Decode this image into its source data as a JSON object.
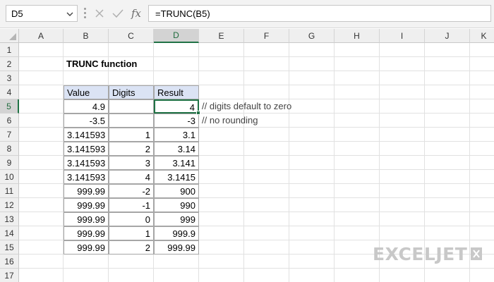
{
  "namebox": {
    "value": "D5"
  },
  "formula_bar": {
    "formula": "=TRUNC(B5)",
    "fx_label": "fx"
  },
  "columns": [
    "A",
    "B",
    "C",
    "D",
    "E",
    "F",
    "G",
    "H",
    "I",
    "J",
    "K"
  ],
  "rows": [
    "1",
    "2",
    "3",
    "4",
    "5",
    "6",
    "7",
    "8",
    "9",
    "10",
    "11",
    "12",
    "13",
    "14",
    "15",
    "16",
    "17"
  ],
  "active_cell": {
    "column": "D",
    "row": "5"
  },
  "sheet": {
    "title": "TRUNC function",
    "table": {
      "headers": [
        "Value",
        "Digits",
        "Result"
      ],
      "rows": [
        {
          "value": "4.9",
          "digits": "",
          "result": "4"
        },
        {
          "value": "-3.5",
          "digits": "",
          "result": "-3"
        },
        {
          "value": "3.141593",
          "digits": "1",
          "result": "3.1"
        },
        {
          "value": "3.141593",
          "digits": "2",
          "result": "3.14"
        },
        {
          "value": "3.141593",
          "digits": "3",
          "result": "3.141"
        },
        {
          "value": "3.141593",
          "digits": "4",
          "result": "3.1415"
        },
        {
          "value": "999.99",
          "digits": "-2",
          "result": "900"
        },
        {
          "value": "999.99",
          "digits": "-1",
          "result": "990"
        },
        {
          "value": "999.99",
          "digits": "0",
          "result": "999"
        },
        {
          "value": "999.99",
          "digits": "1",
          "result": "999.9"
        },
        {
          "value": "999.99",
          "digits": "2",
          "result": "999.99"
        }
      ]
    },
    "notes": [
      "// digits default to zero",
      "// no rounding"
    ]
  },
  "logo": {
    "text": "EXCELJET"
  },
  "colors": {
    "header_fill": "#dbe3f4",
    "selection": "#217346",
    "logo": "#c8c8c8"
  }
}
